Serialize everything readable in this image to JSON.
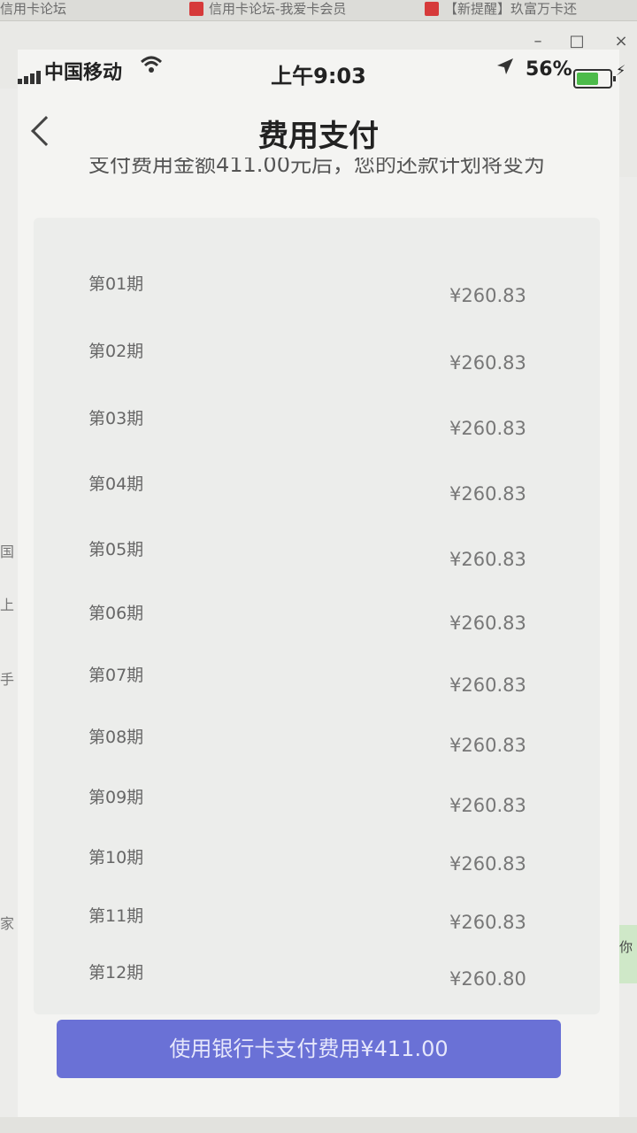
{
  "browser_tabs": [
    {
      "label": "信用卡论坛"
    },
    {
      "label": "信用卡论坛-我爱卡会员"
    },
    {
      "label": "【新提醒】玖富万卡还"
    }
  ],
  "window_controls": {
    "minimize": "–",
    "maximize": "□",
    "close": "×"
  },
  "statusbar": {
    "carrier": "中国移动",
    "time": "上午9:03",
    "battery": "56%",
    "wifi_icon": "wifi-icon",
    "location_icon": "location-arrow-icon"
  },
  "header": {
    "title": "费用支付",
    "back_icon": "chevron-left-icon"
  },
  "intro_text": "支付费用金额411.00元后，您的还款计划将变为",
  "plan": [
    {
      "period": "第01期",
      "amount": "¥260.83"
    },
    {
      "period": "第02期",
      "amount": "¥260.83"
    },
    {
      "period": "第03期",
      "amount": "¥260.83"
    },
    {
      "period": "第04期",
      "amount": "¥260.83"
    },
    {
      "period": "第05期",
      "amount": "¥260.83"
    },
    {
      "period": "第06期",
      "amount": "¥260.83"
    },
    {
      "period": "第07期",
      "amount": "¥260.83"
    },
    {
      "period": "第08期",
      "amount": "¥260.83"
    },
    {
      "period": "第09期",
      "amount": "¥260.83"
    },
    {
      "period": "第10期",
      "amount": "¥260.83"
    },
    {
      "period": "第11期",
      "amount": "¥260.83"
    },
    {
      "period": "第12期",
      "amount": "¥260.80"
    }
  ],
  "pay_button": {
    "label": "使用银行卡支付费用¥411.00"
  },
  "side_left": [
    "国",
    "上",
    "手",
    "家"
  ],
  "side_right_bubble": "包给你",
  "colors": {
    "primary_button": "#6a71d6",
    "battery_fill": "#4cbb4a"
  }
}
